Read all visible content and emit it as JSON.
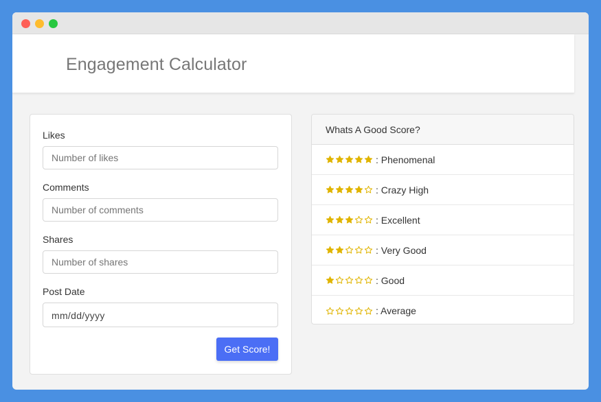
{
  "colors": {
    "accent": "#4b6ef5",
    "star": "#e0b400",
    "background": "#4a90e2"
  },
  "header": {
    "title": "Engagement Calculator"
  },
  "form": {
    "likes_label": "Likes",
    "likes_placeholder": "Number of likes",
    "comments_label": "Comments",
    "comments_placeholder": "Number of comments",
    "shares_label": "Shares",
    "shares_placeholder": "Number of shares",
    "date_label": "Post Date",
    "date_placeholder": "mm/dd/yyyy",
    "submit_label": "Get Score!"
  },
  "scores": {
    "title": "Whats A Good Score?",
    "items": [
      {
        "stars": 5,
        "label": ": Phenomenal"
      },
      {
        "stars": 4,
        "label": ": Crazy High"
      },
      {
        "stars": 3,
        "label": ": Excellent"
      },
      {
        "stars": 2,
        "label": ": Very Good"
      },
      {
        "stars": 1,
        "label": ": Good"
      },
      {
        "stars": 0,
        "label": ": Average"
      }
    ]
  }
}
